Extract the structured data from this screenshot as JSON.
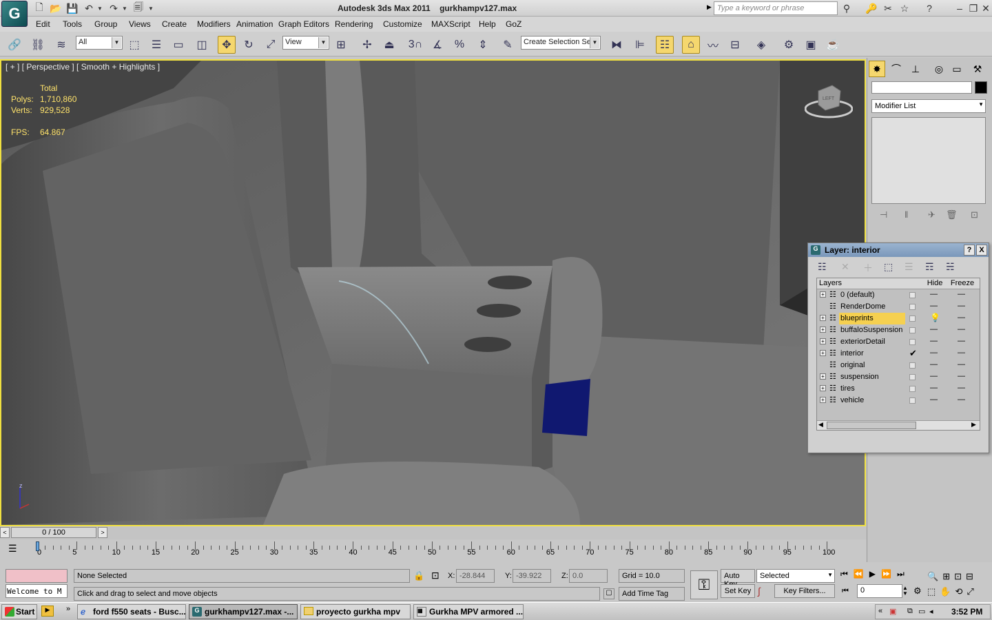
{
  "titlebar": {
    "app_name": "Autodesk 3ds Max  2011",
    "file_name": "gurkhampv127.max",
    "search_placeholder": "Type a keyword or phrase"
  },
  "menu": [
    "Edit",
    "Tools",
    "Group",
    "Views",
    "Create",
    "Modifiers",
    "Animation",
    "Graph Editors",
    "Rendering",
    "Customize",
    "MAXScript",
    "Help",
    "GoZ"
  ],
  "toolbar": {
    "selection_filter": "All",
    "ref_coord": "View",
    "snap_number": "3",
    "named_selection": "Create Selection Se"
  },
  "viewport": {
    "label": "[ + ] [ Perspective ] [ Smooth + Highlights ]",
    "stats": {
      "header": "Total",
      "polys_label": "Polys:",
      "polys": "1,710,860",
      "verts_label": "Verts:",
      "verts": "929,528",
      "fps_label": "FPS:",
      "fps": "64.867"
    },
    "viewcube_label": "LEFT",
    "axis_z": "z"
  },
  "command_panel": {
    "modifier_list": "Modifier List"
  },
  "layer_dialog": {
    "title": "Layer: interior",
    "help": "?",
    "close": "X",
    "col_layers": "Layers",
    "col_hide": "Hide",
    "col_freeze": "Freeze",
    "rows": [
      {
        "name": "0 (default)",
        "expand": true,
        "current": false,
        "selected": false,
        "hide": "—",
        "freeze": "—"
      },
      {
        "name": "RenderDome",
        "expand": false,
        "current": false,
        "selected": false,
        "hide": "—",
        "freeze": "—"
      },
      {
        "name": "blueprints",
        "expand": true,
        "current": false,
        "selected": true,
        "hide": "bulb",
        "freeze": "—"
      },
      {
        "name": "buffaloSuspension",
        "expand": true,
        "current": false,
        "selected": false,
        "hide": "—",
        "freeze": "—"
      },
      {
        "name": "exteriorDetail",
        "expand": true,
        "current": false,
        "selected": false,
        "hide": "—",
        "freeze": "—"
      },
      {
        "name": "interior",
        "expand": true,
        "current": true,
        "selected": false,
        "hide": "—",
        "freeze": "—"
      },
      {
        "name": "original",
        "expand": false,
        "current": false,
        "selected": false,
        "hide": "—",
        "freeze": "—"
      },
      {
        "name": "suspension",
        "expand": true,
        "current": false,
        "selected": false,
        "hide": "—",
        "freeze": "—"
      },
      {
        "name": "tires",
        "expand": true,
        "current": false,
        "selected": false,
        "hide": "—",
        "freeze": "—"
      },
      {
        "name": "vehicle",
        "expand": true,
        "current": false,
        "selected": false,
        "hide": "—",
        "freeze": "—"
      }
    ]
  },
  "timeline": {
    "frame_display": "0 / 100",
    "ticks": [
      "0",
      "5",
      "10",
      "15",
      "20",
      "25",
      "30",
      "35",
      "40",
      "45",
      "50",
      "55",
      "60",
      "65",
      "70",
      "75",
      "80",
      "85",
      "90",
      "95",
      "100"
    ]
  },
  "status": {
    "maxscript_text": "Welcome to M",
    "selection_status": "None Selected",
    "prompt": "Click and drag to select and move objects",
    "x_label": "X:",
    "x_value": "-28.844",
    "y_label": "Y:",
    "y_value": "-39.922",
    "z_label": "Z:",
    "z_value": "0.0",
    "grid": "Grid = 10.0",
    "add_time_tag": "Add Time Tag",
    "auto_key": "Auto Key",
    "set_key": "Set Key",
    "key_mode": "Selected",
    "key_filters": "Key Filters...",
    "current_frame": "0"
  },
  "taskbar": {
    "start": "Start",
    "tasks": [
      {
        "label": "ford f550 seats - Busc...",
        "active": false
      },
      {
        "label": "gurkhampv127.max -...",
        "active": true
      },
      {
        "label": "proyecto gurkha mpv",
        "active": false
      },
      {
        "label": "Gurkha MPV armored ...",
        "active": false
      }
    ],
    "clock": "3:52 PM"
  },
  "colors": {
    "viewport_border": "#f0e040",
    "stats_text": "#ffe36b",
    "selected_layer": "#f5d050",
    "active_tool": "#f5d76e"
  }
}
